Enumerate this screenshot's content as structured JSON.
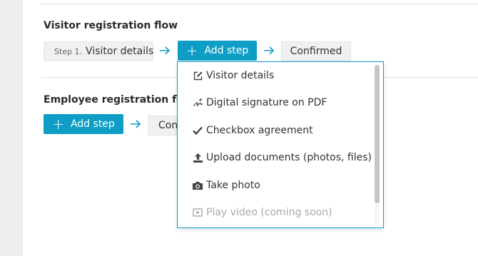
{
  "colors": {
    "accent": "#0e9ec5",
    "chip_bg": "#eef0f2",
    "text": "#2b2b2b",
    "disabled_text": "#a6a9ad"
  },
  "visitor_flow": {
    "title": "Visitor registration flow",
    "step": {
      "number": "Step 1.",
      "label": "Visitor details"
    },
    "add_step_label": "Add step",
    "confirmed_label": "Confirmed"
  },
  "employee_flow": {
    "title": "Employee registration flow",
    "add_step_label": "Add step",
    "confirmed_label_visible": "Con"
  },
  "add_step_menu": {
    "items": [
      {
        "label": "Visitor details",
        "icon": "edit-icon",
        "enabled": true
      },
      {
        "label": "Digital signature on PDF",
        "icon": "signature-icon",
        "enabled": true
      },
      {
        "label": "Checkbox agreement",
        "icon": "checkmark-icon",
        "enabled": true
      },
      {
        "label": "Upload documents (photos, files)",
        "icon": "upload-icon",
        "enabled": true
      },
      {
        "label": "Take photo",
        "icon": "camera-icon",
        "enabled": true
      },
      {
        "label": "Play video (coming soon)",
        "icon": "play-video-icon",
        "enabled": false
      }
    ]
  }
}
